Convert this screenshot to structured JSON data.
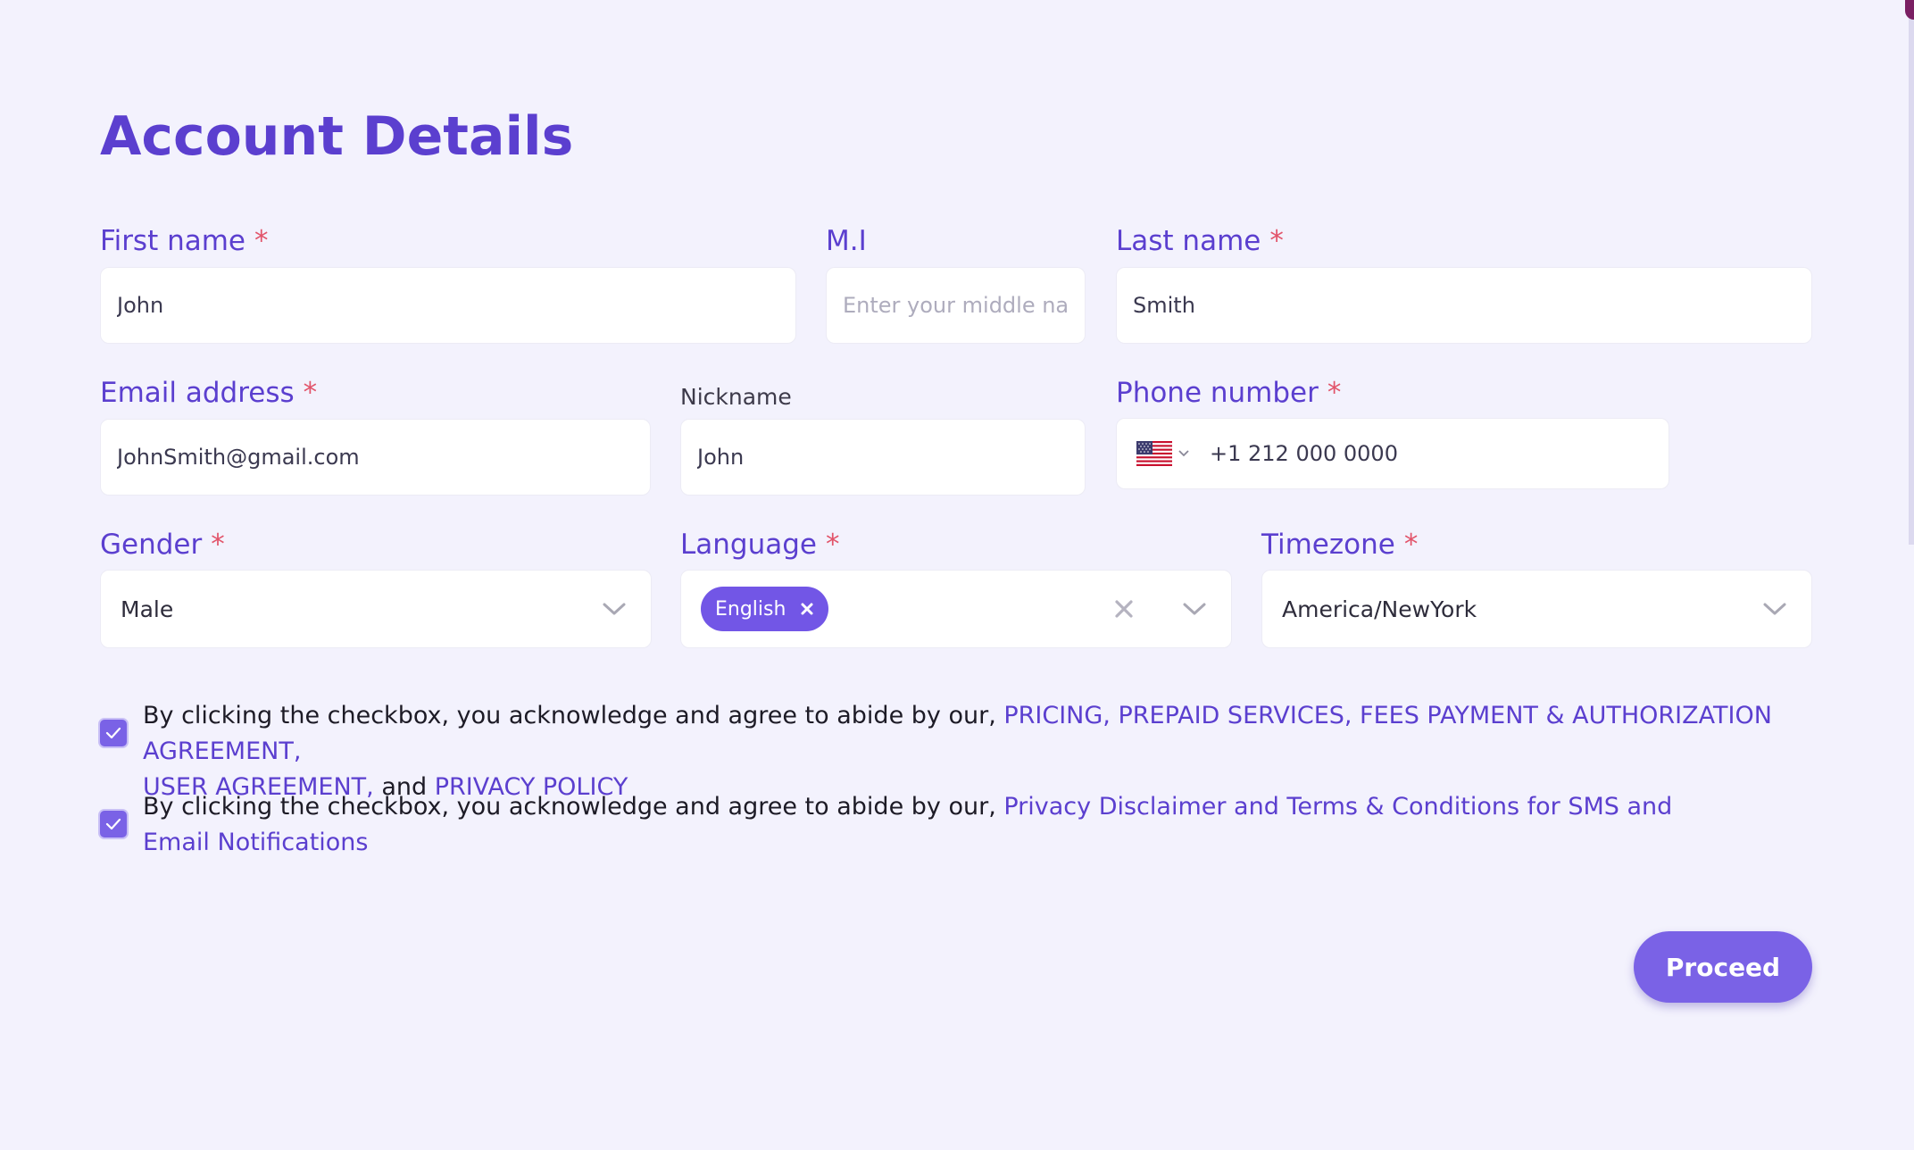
{
  "page": {
    "title": "Account Details"
  },
  "form": {
    "first_name": {
      "label": "First name",
      "required_mark": "*",
      "value": "John"
    },
    "middle_initial": {
      "label": "M.I",
      "value": "",
      "placeholder": "Enter your middle name"
    },
    "last_name": {
      "label": "Last name",
      "required_mark": "*",
      "value": "Smith"
    },
    "email": {
      "label": "Email address",
      "required_mark": "*",
      "value": "JohnSmith@gmail.com"
    },
    "nickname": {
      "label": "Nickname",
      "value": "John"
    },
    "phone": {
      "label": "Phone number",
      "required_mark": "*",
      "value": "+1 212 000 0000",
      "country_icon": "us-flag-icon"
    },
    "gender": {
      "label": "Gender",
      "required_mark": "*",
      "value": "Male"
    },
    "language": {
      "label": "Language",
      "required_mark": "*",
      "selected": [
        "English"
      ]
    },
    "timezone": {
      "label": "Timezone",
      "required_mark": "*",
      "value": "America/NewYork"
    }
  },
  "agreements": [
    {
      "checked": true,
      "text": "By clicking the checkbox, you acknowledge and agree to abide by our, ",
      "link1": "PRICING, PREPAID SERVICES, FEES PAYMENT & AUTHORIZATION AGREEMENT,",
      "link2": "USER AGREEMENT,",
      "conjunction": " and ",
      "link3": "PRIVACY POLICY"
    },
    {
      "checked": true,
      "text": "By clicking the checkbox, you acknowledge and agree to abide by our, ",
      "link1": "Privacy Disclaimer and Terms & Conditions for SMS and Email Notifications"
    }
  ],
  "actions": {
    "proceed_label": "Proceed"
  },
  "colors": {
    "accent": "#5b3fcf",
    "button": "#7a62e6",
    "required": "#e2546a",
    "background": "#f3f2fd"
  }
}
